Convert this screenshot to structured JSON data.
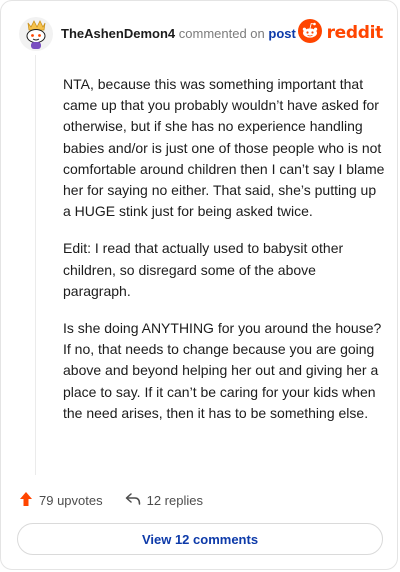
{
  "comment": {
    "username": "TheAshenDemon4",
    "action_text": "commented on",
    "post_link": "post",
    "paragraphs": [
      "NTA, because this was something important that came up that you probably wouldn’t have asked for otherwise, but if she has no experience handling babies and/or is just one of those people who is not comfortable around children then I can’t say I blame her for saying no either. That said, she’s putting up a HUGE stink just for being asked twice.",
      "Edit: I read that actually used to babysit other children, so disregard some of the above paragraph.",
      "Is she doing ANYTHING for you around the house? If no, that needs to change because you are going above and beyond helping her out and giving her a place to say. If it can’t be caring for your kids when the need arises, then it has to be something else."
    ]
  },
  "brand": {
    "logo_text": "reddit",
    "color": "#ff4500"
  },
  "actions": {
    "upvotes": "79 upvotes",
    "replies": "12 replies"
  },
  "footer": {
    "view_label": "View 12 comments"
  },
  "icons": {
    "avatar": "snoo-avatar-icon",
    "logo": "reddit-logo-icon",
    "upvote": "upvote-arrow-icon",
    "reply": "reply-arrow-icon"
  }
}
